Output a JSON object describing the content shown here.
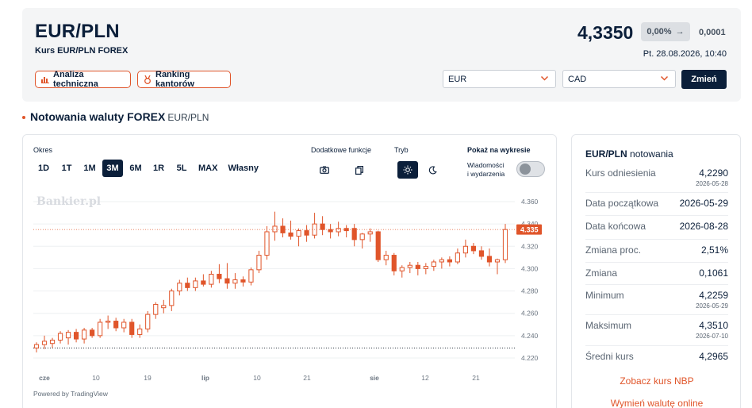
{
  "header": {
    "title": "EUR/PLN",
    "subtitle": "Kurs EUR/PLN FOREX",
    "price": "4,3350",
    "change_pct": "0,00%",
    "change_arrow": "→",
    "change_abs": "0,0001",
    "datetime": "Pt. 28.08.2026, 10:40",
    "btn_analysis": "Analiza techniczna",
    "btn_exchanges": "Ranking kantorów",
    "select_from": "EUR",
    "select_to": "CAD",
    "btn_change": "Zmień",
    "accent_color": "#e0552a",
    "navy_color": "#0b1f3a"
  },
  "section": {
    "title": "Notowania waluty FOREX",
    "pair": "EUR/PLN"
  },
  "chart_panel": {
    "okres_label": "Okres",
    "periods": [
      "1D",
      "1T",
      "1M",
      "3M",
      "6M",
      "1R",
      "5L",
      "MAX",
      "Własny"
    ],
    "active_period": "3M",
    "extra_label": "Dodatkowe funkcje",
    "mode_label": "Tryb",
    "show_label": "Pokaż na wykresie",
    "news_toggle_label_1": "Wiadomości",
    "news_toggle_label_2": "i wydarzenia",
    "news_toggle_on": false,
    "watermark": "Bankier.pl",
    "powered_by": "Powered by TradingView",
    "icons": [
      "camera-icon",
      "copy-icon",
      "sun-icon",
      "moon-icon"
    ]
  },
  "chart_data": {
    "type": "candlestick",
    "y_ticks": [
      "4.360",
      "4.340",
      "4.320",
      "4.300",
      "4.280",
      "4.260",
      "4.240",
      "4.220"
    ],
    "y_range": [
      4.22,
      4.36
    ],
    "x_ticks": [
      "cze",
      "10",
      "19",
      "lip",
      "10",
      "21",
      "sie",
      "12",
      "21"
    ],
    "current_price_label": "4.335",
    "baseline": 4.229,
    "up_color": "#ffffff",
    "down_color": "#e0552a",
    "candles": [
      {
        "o": 4.229,
        "h": 4.234,
        "l": 4.225,
        "c": 4.232
      },
      {
        "o": 4.232,
        "h": 4.24,
        "l": 4.228,
        "c": 4.235
      },
      {
        "o": 4.233,
        "h": 4.238,
        "l": 4.229,
        "c": 4.236
      },
      {
        "o": 4.236,
        "h": 4.244,
        "l": 4.233,
        "c": 4.242
      },
      {
        "o": 4.238,
        "h": 4.245,
        "l": 4.232,
        "c": 4.243
      },
      {
        "o": 4.243,
        "h": 4.246,
        "l": 4.234,
        "c": 4.237
      },
      {
        "o": 4.237,
        "h": 4.247,
        "l": 4.233,
        "c": 4.245
      },
      {
        "o": 4.245,
        "h": 4.247,
        "l": 4.238,
        "c": 4.24
      },
      {
        "o": 4.24,
        "h": 4.255,
        "l": 4.238,
        "c": 4.252
      },
      {
        "o": 4.252,
        "h": 4.258,
        "l": 4.246,
        "c": 4.253
      },
      {
        "o": 4.253,
        "h": 4.256,
        "l": 4.244,
        "c": 4.247
      },
      {
        "o": 4.247,
        "h": 4.255,
        "l": 4.243,
        "c": 4.252
      },
      {
        "o": 4.252,
        "h": 4.255,
        "l": 4.238,
        "c": 4.241
      },
      {
        "o": 4.241,
        "h": 4.25,
        "l": 4.238,
        "c": 4.246
      },
      {
        "o": 4.246,
        "h": 4.262,
        "l": 4.243,
        "c": 4.259
      },
      {
        "o": 4.259,
        "h": 4.27,
        "l": 4.255,
        "c": 4.268
      },
      {
        "o": 4.265,
        "h": 4.272,
        "l": 4.26,
        "c": 4.267
      },
      {
        "o": 4.267,
        "h": 4.282,
        "l": 4.262,
        "c": 4.28
      },
      {
        "o": 4.28,
        "h": 4.29,
        "l": 4.276,
        "c": 4.287
      },
      {
        "o": 4.287,
        "h": 4.292,
        "l": 4.28,
        "c": 4.283
      },
      {
        "o": 4.283,
        "h": 4.292,
        "l": 4.28,
        "c": 4.289
      },
      {
        "o": 4.289,
        "h": 4.295,
        "l": 4.284,
        "c": 4.286
      },
      {
        "o": 4.286,
        "h": 4.298,
        "l": 4.283,
        "c": 4.295
      },
      {
        "o": 4.295,
        "h": 4.304,
        "l": 4.287,
        "c": 4.291
      },
      {
        "o": 4.291,
        "h": 4.305,
        "l": 4.282,
        "c": 4.287
      },
      {
        "o": 4.287,
        "h": 4.296,
        "l": 4.282,
        "c": 4.29
      },
      {
        "o": 4.29,
        "h": 4.293,
        "l": 4.284,
        "c": 4.288
      },
      {
        "o": 4.288,
        "h": 4.301,
        "l": 4.285,
        "c": 4.299
      },
      {
        "o": 4.299,
        "h": 4.316,
        "l": 4.296,
        "c": 4.312
      },
      {
        "o": 4.312,
        "h": 4.338,
        "l": 4.308,
        "c": 4.333
      },
      {
        "o": 4.333,
        "h": 4.351,
        "l": 4.325,
        "c": 4.338
      },
      {
        "o": 4.338,
        "h": 4.345,
        "l": 4.328,
        "c": 4.332
      },
      {
        "o": 4.332,
        "h": 4.343,
        "l": 4.326,
        "c": 4.329
      },
      {
        "o": 4.329,
        "h": 4.336,
        "l": 4.32,
        "c": 4.334
      },
      {
        "o": 4.334,
        "h": 4.339,
        "l": 4.324,
        "c": 4.33
      },
      {
        "o": 4.33,
        "h": 4.35,
        "l": 4.327,
        "c": 4.34
      },
      {
        "o": 4.34,
        "h": 4.347,
        "l": 4.33,
        "c": 4.335
      },
      {
        "o": 4.335,
        "h": 4.34,
        "l": 4.327,
        "c": 4.333
      },
      {
        "o": 4.333,
        "h": 4.342,
        "l": 4.329,
        "c": 4.336
      },
      {
        "o": 4.336,
        "h": 4.339,
        "l": 4.328,
        "c": 4.334
      },
      {
        "o": 4.336,
        "h": 4.34,
        "l": 4.32,
        "c": 4.326
      },
      {
        "o": 4.326,
        "h": 4.332,
        "l": 4.318,
        "c": 4.331
      },
      {
        "o": 4.331,
        "h": 4.336,
        "l": 4.324,
        "c": 4.333
      },
      {
        "o": 4.333,
        "h": 4.334,
        "l": 4.306,
        "c": 4.308
      },
      {
        "o": 4.308,
        "h": 4.316,
        "l": 4.303,
        "c": 4.312
      },
      {
        "o": 4.312,
        "h": 4.314,
        "l": 4.294,
        "c": 4.298
      },
      {
        "o": 4.298,
        "h": 4.303,
        "l": 4.292,
        "c": 4.301
      },
      {
        "o": 4.301,
        "h": 4.306,
        "l": 4.296,
        "c": 4.303
      },
      {
        "o": 4.303,
        "h": 4.306,
        "l": 4.294,
        "c": 4.3
      },
      {
        "o": 4.3,
        "h": 4.305,
        "l": 4.295,
        "c": 4.302
      },
      {
        "o": 4.302,
        "h": 4.308,
        "l": 4.298,
        "c": 4.306
      },
      {
        "o": 4.306,
        "h": 4.31,
        "l": 4.3,
        "c": 4.308
      },
      {
        "o": 4.308,
        "h": 4.311,
        "l": 4.302,
        "c": 4.306
      },
      {
        "o": 4.306,
        "h": 4.318,
        "l": 4.304,
        "c": 4.314
      },
      {
        "o": 4.314,
        "h": 4.326,
        "l": 4.31,
        "c": 4.32
      },
      {
        "o": 4.32,
        "h": 4.323,
        "l": 4.313,
        "c": 4.316
      },
      {
        "o": 4.316,
        "h": 4.32,
        "l": 4.308,
        "c": 4.311
      },
      {
        "o": 4.311,
        "h": 4.318,
        "l": 4.302,
        "c": 4.306
      },
      {
        "o": 4.306,
        "h": 4.309,
        "l": 4.295,
        "c": 4.308
      },
      {
        "o": 4.308,
        "h": 4.34,
        "l": 4.305,
        "c": 4.335
      }
    ]
  },
  "stats": {
    "title_pair": "EUR/PLN",
    "title_rest": "notowania",
    "rows": [
      {
        "label": "Kurs odniesienia",
        "value": "4,2290",
        "date": "2026-05-28"
      },
      {
        "label": "Data początkowa",
        "value": "2026-05-29",
        "date": ""
      },
      {
        "label": "Data końcowa",
        "value": "2026-08-28",
        "date": ""
      },
      {
        "label": "Zmiana proc.",
        "value": "2,51%",
        "date": ""
      },
      {
        "label": "Zmiana",
        "value": "0,1061",
        "date": ""
      },
      {
        "label": "Minimum",
        "value": "4,2259",
        "date": "2026-05-29"
      },
      {
        "label": "Maksimum",
        "value": "4,3510",
        "date": "2026-07-10"
      },
      {
        "label": "Średni kurs",
        "value": "4,2965",
        "date": ""
      }
    ],
    "link_nbp": "Zobacz kurs NBP",
    "link_exchange": "Wymień walutę online"
  }
}
